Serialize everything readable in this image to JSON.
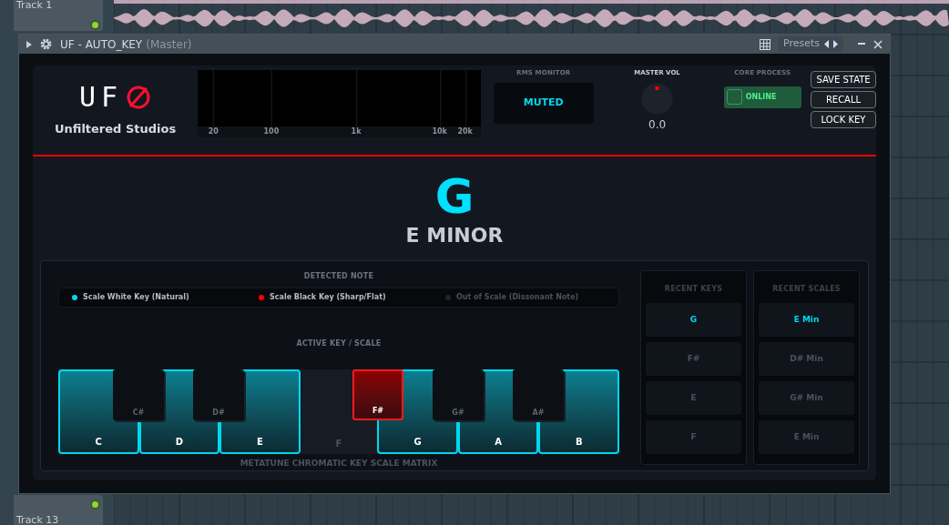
{
  "playlist": {
    "tracks": [
      {
        "label": "Track 1"
      },
      {
        "label": "Track 13"
      }
    ]
  },
  "window": {
    "title": "UF - AUTO_KEY",
    "subtitle": "(Master)",
    "presets_label": "Presets"
  },
  "header": {
    "logo_text": "UF",
    "brand": "Unfiltered Studios",
    "spectrum_labels": [
      "20",
      "100",
      "1k",
      "10k",
      "20k"
    ],
    "rms": {
      "label": "RMS MONITOR",
      "value": "MUTED"
    },
    "master_vol": {
      "label": "MASTER VOL",
      "value": "0.0"
    },
    "core": {
      "label": "CORE PROCESS",
      "state_text": "ONLINE",
      "on": true
    },
    "buttons": [
      "SAVE STATE",
      "RECALL",
      "LOCK KEY"
    ]
  },
  "detected": {
    "note": "G",
    "scale": "E MINOR"
  },
  "legend": {
    "title": "DETECTED NOTE",
    "items": [
      {
        "label": "Scale White Key (Natural)",
        "color": "#00d8f0",
        "dim": false
      },
      {
        "label": "Scale Black Key (Sharp/Flat)",
        "color": "#ff0000",
        "dim": false
      },
      {
        "label": "Out of Scale (Dissonant Note)",
        "color": "#1e2430",
        "dim": true
      }
    ]
  },
  "keyboard": {
    "title": "ACTIVE KEY / SCALE",
    "footer": "METATUNE CHROMATIC KEY SCALE MATRIX",
    "white_keys": [
      {
        "label": "C",
        "in_scale": true
      },
      {
        "label": "D",
        "in_scale": true
      },
      {
        "label": "E",
        "in_scale": true
      },
      {
        "label": "F",
        "in_scale": false
      },
      {
        "label": "G",
        "in_scale": true
      },
      {
        "label": "A",
        "in_scale": true
      },
      {
        "label": "B",
        "in_scale": true
      }
    ],
    "black_keys": [
      {
        "label": "C#",
        "in_scale": false
      },
      {
        "label": "D#",
        "in_scale": false
      },
      {
        "label": "F#",
        "in_scale": true
      },
      {
        "label": "G#",
        "in_scale": false
      },
      {
        "label": "A#",
        "in_scale": false
      }
    ]
  },
  "recent_keys": {
    "title": "RECENT KEYS",
    "items": [
      {
        "label": "G",
        "selected": true
      },
      {
        "label": "F#",
        "selected": false
      },
      {
        "label": "E",
        "selected": false
      },
      {
        "label": "F",
        "selected": false
      }
    ]
  },
  "recent_scales": {
    "title": "RECENT SCALES",
    "items": [
      {
        "label": "E Min",
        "selected": true
      },
      {
        "label": "D# Min",
        "selected": false
      },
      {
        "label": "G# Min",
        "selected": false
      },
      {
        "label": "E Min",
        "selected": false
      }
    ]
  }
}
